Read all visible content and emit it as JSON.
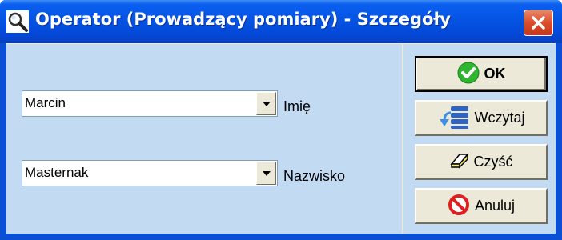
{
  "window": {
    "title": "Operator (Prowadzący pomiary) - Szczegóły",
    "title_icon": "magnifier-icon",
    "close_icon": "close-icon"
  },
  "fields": [
    {
      "value": "Marcin",
      "label": "Imię"
    },
    {
      "value": "Masternak",
      "label": "Nazwisko"
    }
  ],
  "buttons": {
    "ok": {
      "label": "OK",
      "icon": "check-icon"
    },
    "load": {
      "label": "Wczytaj",
      "icon": "load-list-icon"
    },
    "clear": {
      "label": "Czyść",
      "icon": "eraser-icon"
    },
    "cancel": {
      "label": "Anuluj",
      "icon": "cancel-icon"
    }
  },
  "colors": {
    "titlebar": "#0554e3",
    "panel": "#c3daf3",
    "close": "#dc4d2c",
    "ok_icon": "#2fb52f",
    "cancel_icon": "#e02020"
  }
}
